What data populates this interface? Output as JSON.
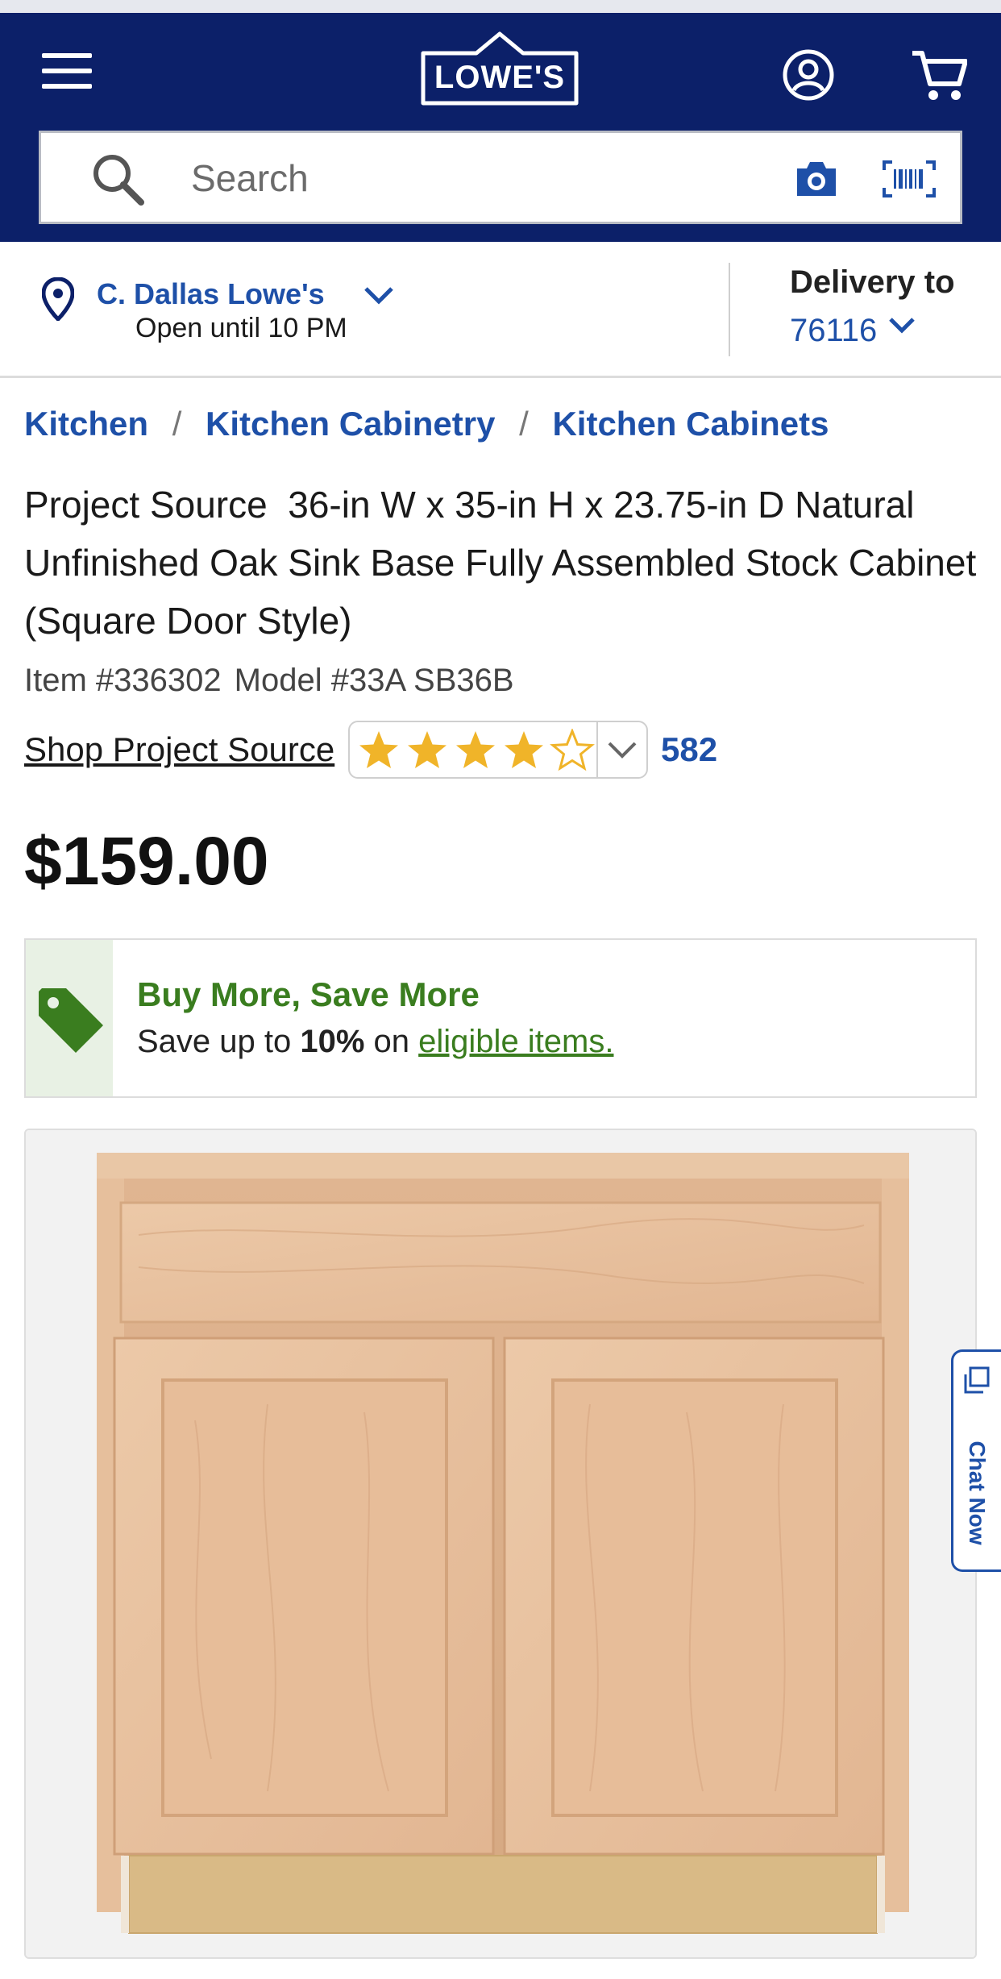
{
  "header": {
    "logo_text": "LOWE'S",
    "menu_icon": "hamburger-menu-icon",
    "account_icon": "account-circle-icon",
    "cart_icon": "shopping-cart-icon",
    "brand_color": "#0c2069"
  },
  "search": {
    "placeholder": "Search",
    "camera_icon": "camera-icon",
    "barcode_icon": "barcode-scanner-icon"
  },
  "store": {
    "name": "C. Dallas Lowe's",
    "hours": "Open until 10 PM",
    "delivery_label": "Delivery to",
    "zip": "76116"
  },
  "breadcrumb": [
    {
      "label": "Kitchen"
    },
    {
      "label": "Kitchen Cabinetry"
    },
    {
      "label": "Kitchen Cabinets"
    }
  ],
  "breadcrumb_separator": "/",
  "product": {
    "title": "Project Source  36-in W x 35-in H x 23.75-in D Natural Unfinished Oak Sink Base Fully Assembled Stock Cabinet (Square Door Style)",
    "item_number": "Item #336302",
    "model_number": "Model #33A SB36B",
    "shop_brand": "Shop Project Source",
    "rating": 4,
    "rating_max": 5,
    "review_count": "582",
    "price": "$159.00"
  },
  "promo": {
    "title": "Buy More, Save More",
    "text_prefix": "Save up to ",
    "percent": "10%",
    "text_mid": " on ",
    "link": "eligible items.",
    "accent_color": "#3a7d1f"
  },
  "chat": {
    "label": "Chat Now"
  },
  "colors": {
    "link_blue": "#1e50a8",
    "star_gold": "#f0b429"
  }
}
